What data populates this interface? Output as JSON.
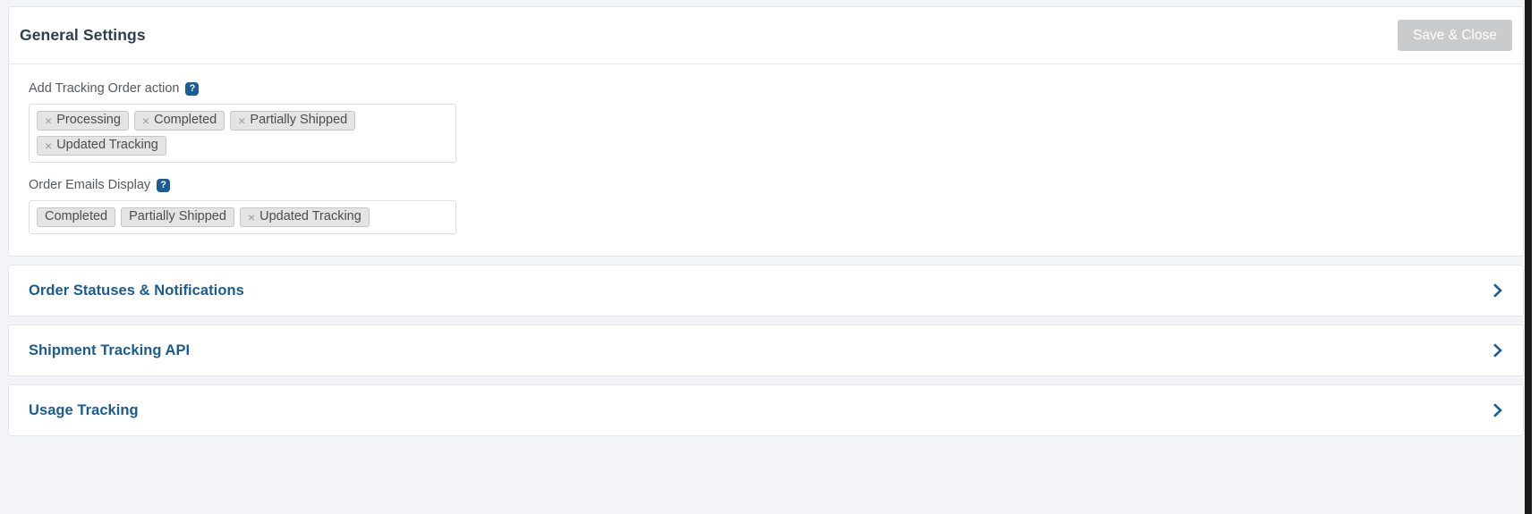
{
  "general_settings": {
    "title": "General Settings",
    "save_label": "Save & Close",
    "fields": [
      {
        "label": "Add Tracking Order action",
        "help_icon": "help-question-icon",
        "tags": [
          {
            "label": "Processing",
            "removable": true,
            "remove_icon": "close-x-icon"
          },
          {
            "label": "Completed",
            "removable": true,
            "remove_icon": "close-x-icon"
          },
          {
            "label": "Partially Shipped",
            "removable": true,
            "remove_icon": "close-x-icon"
          },
          {
            "label": "Updated Tracking",
            "removable": true,
            "remove_icon": "close-x-icon"
          }
        ]
      },
      {
        "label": "Order Emails Display",
        "help_icon": "help-question-icon",
        "tags": [
          {
            "label": "Completed",
            "removable": false
          },
          {
            "label": "Partially Shipped",
            "removable": false
          },
          {
            "label": "Updated Tracking",
            "removable": true,
            "remove_icon": "close-x-icon"
          }
        ]
      }
    ]
  },
  "sections": [
    {
      "title": "Order Statuses & Notifications",
      "chevron_icon": "chevron-right-icon"
    },
    {
      "title": "Shipment Tracking API",
      "chevron_icon": "chevron-right-icon"
    },
    {
      "title": "Usage Tracking",
      "chevron_icon": "chevron-right-icon"
    }
  ],
  "colors": {
    "page_background": "#f3f4f7",
    "card_background": "#ffffff",
    "accent_blue": "#1a5c94",
    "title_dark": "#2c3e50",
    "disabled_button": "#c9cbcd",
    "tag_background": "#e4e4e4",
    "tag_border": "#c6c6c6",
    "border": "#e4e6ea"
  },
  "x_glyph": "×"
}
